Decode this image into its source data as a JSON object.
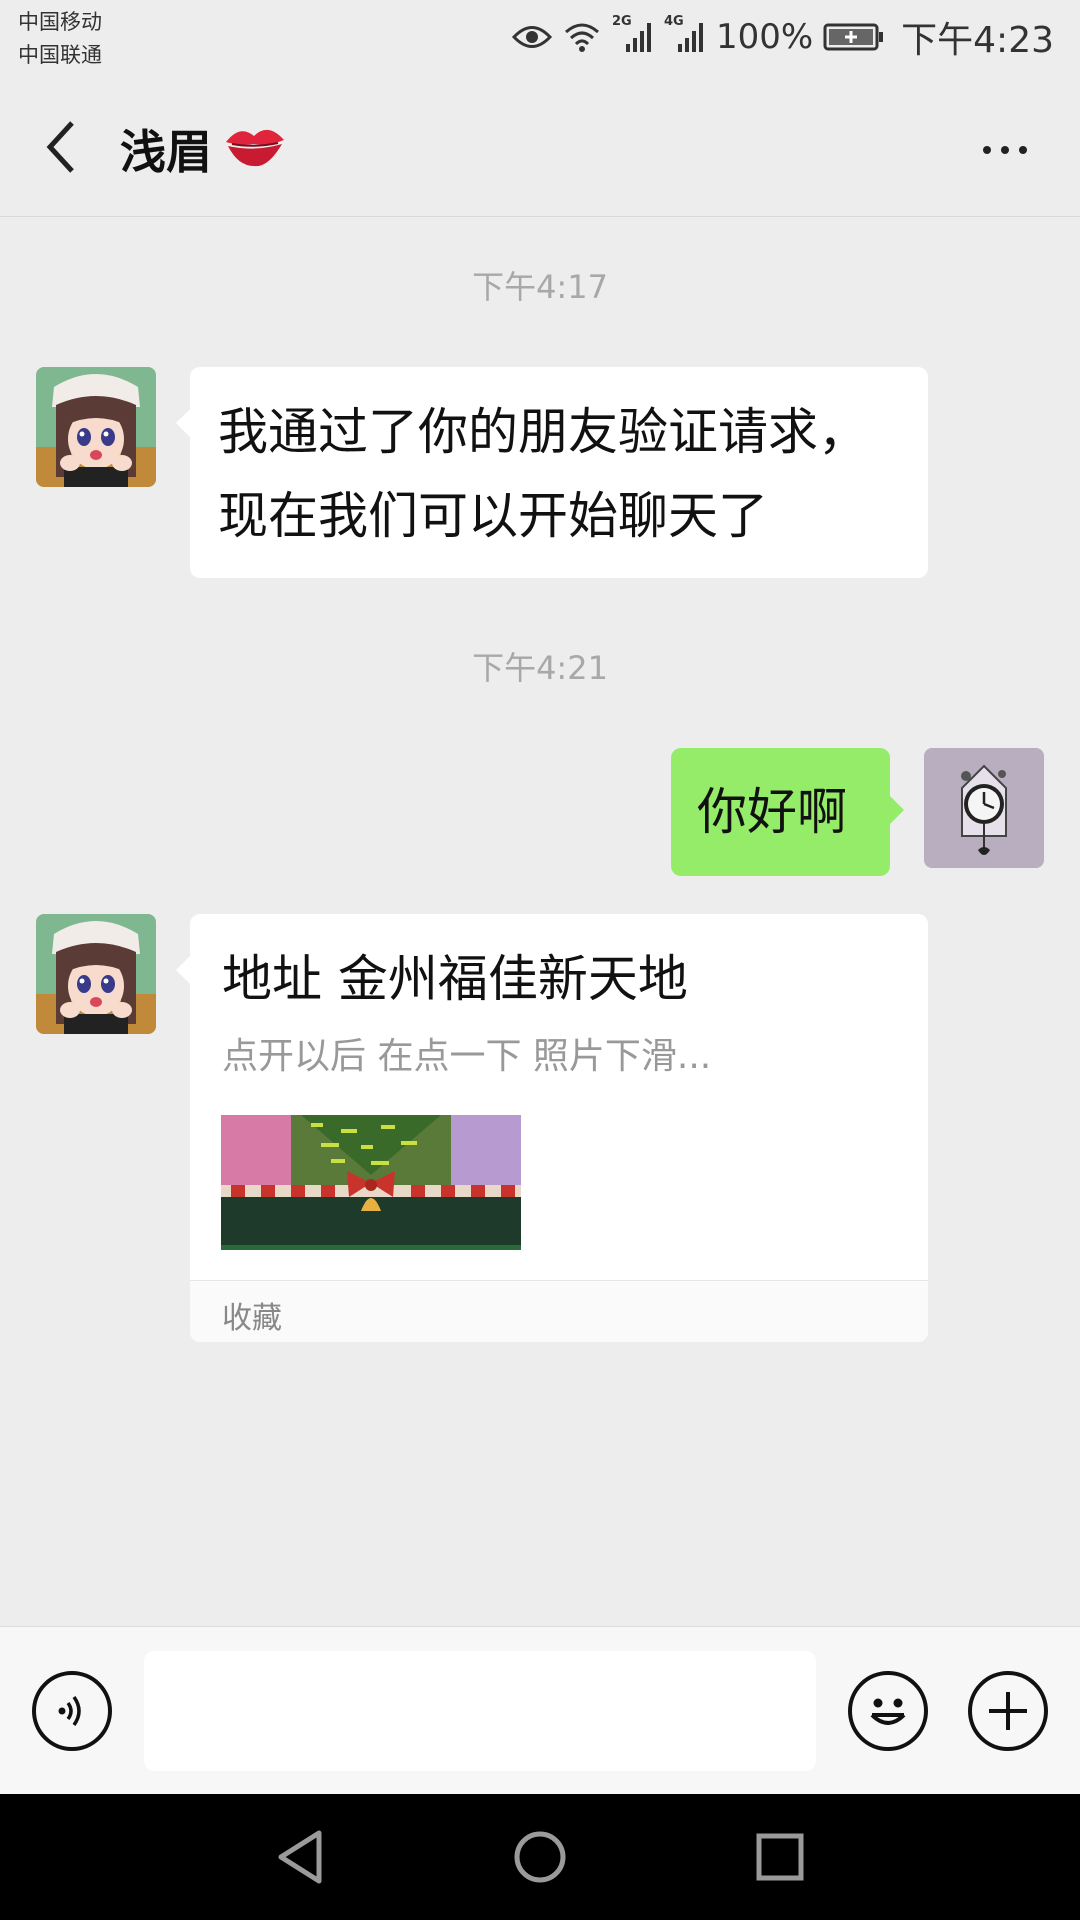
{
  "status_bar": {
    "carrier_1": "中国移动",
    "carrier_2": "中国联通",
    "network_1": "2G",
    "network_2": "4G",
    "battery": "100%",
    "time": "下午4:23",
    "icons": [
      "eye-icon",
      "wifi-icon",
      "signal-icon",
      "battery-icon"
    ]
  },
  "nav": {
    "back_icon": "chevron-left-icon",
    "title": "浅眉",
    "title_emoji": "kiss-mark-icon",
    "more_icon": "more-dots-icon"
  },
  "chat": {
    "messages": [
      {
        "type": "timestamp",
        "text": "下午4:17"
      },
      {
        "type": "text",
        "side": "left",
        "lines": [
          "我通过了你的朋友验证请求，",
          "现在我们可以开始聊天了"
        ]
      },
      {
        "type": "timestamp",
        "text": "下午4:21"
      },
      {
        "type": "text",
        "side": "right",
        "text": "你好啊"
      },
      {
        "type": "card",
        "side": "left",
        "title": "地址  金州福佳新天地",
        "subtitle": "点开以后  在点一下 照片下滑...",
        "footer": "收藏"
      }
    ]
  },
  "input_bar": {
    "voice_icon": "voice-icon",
    "placeholder": "",
    "emoji_icon": "emoji-icon",
    "plus_icon": "plus-icon"
  },
  "system_nav": {
    "back": "triangle-back-icon",
    "home": "circle-home-icon",
    "recents": "square-recents-icon"
  },
  "colors": {
    "background": "#ededed",
    "sent_bubble": "#95ec69",
    "received_bubble": "#ffffff",
    "timestamp": "#a8a8a8"
  }
}
